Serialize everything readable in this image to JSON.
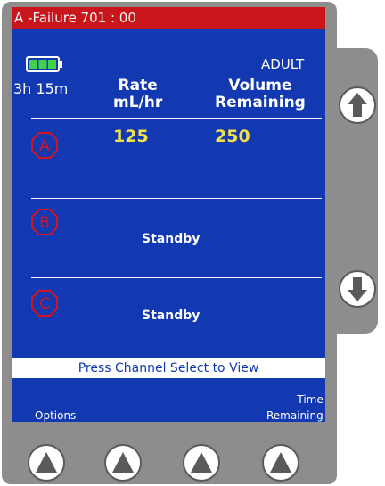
{
  "alarm_bar": {
    "text": "A -Failure 701 : 00",
    "color": "#c8161c"
  },
  "status": {
    "battery_icon": "battery-full-icon",
    "patient_type": "ADULT",
    "battery_time": "3h 15m"
  },
  "headers": {
    "rate_line1": "Rate",
    "rate_line2": "mL/hr",
    "volume_line1": "Volume",
    "volume_line2": "Remaining"
  },
  "channels": [
    {
      "label": "A",
      "rate": "125",
      "volume": "250",
      "status": ""
    },
    {
      "label": "B",
      "rate": "",
      "volume": "",
      "status": "Standby"
    },
    {
      "label": "C",
      "rate": "",
      "volume": "",
      "status": "Standby"
    }
  ],
  "prompt": "Press Channel Select to View",
  "softkeys": {
    "left": "Options",
    "right_line1": "Time",
    "right_line2": "Remaining"
  },
  "colors": {
    "screen": "#1238b2",
    "bezel": "#8d8d8d",
    "values": "#f0e04a",
    "channel_badge": "#d8131b"
  }
}
